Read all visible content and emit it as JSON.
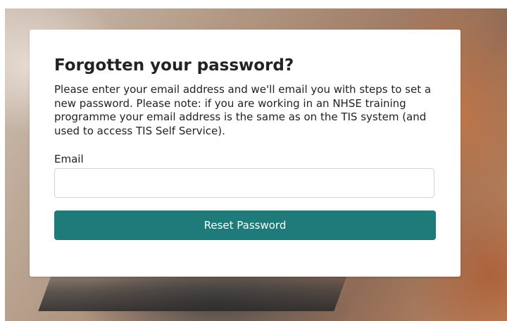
{
  "form": {
    "title": "Forgotten your password?",
    "description": "Please enter your email address and we'll email you with steps to set a new password. Please note: if you are working in an NHSE training programme your email address is the same as on the TIS system (and used to access TIS Self Service).",
    "email_label": "Email",
    "email_value": "",
    "email_placeholder": "",
    "reset_button_label": "Reset Password"
  },
  "colors": {
    "button_background": "#1e7b79",
    "button_text": "#ffffff",
    "card_background": "#ffffff",
    "text": "#222222"
  }
}
